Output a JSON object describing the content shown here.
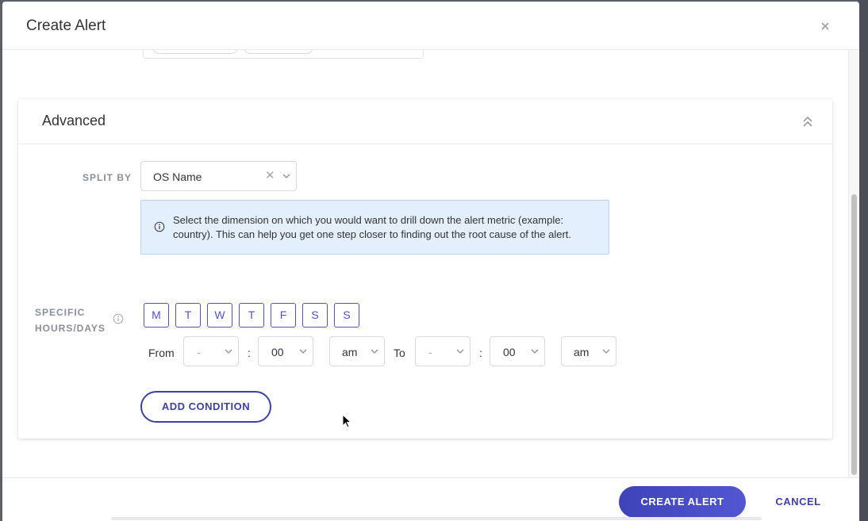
{
  "modal": {
    "title": "Create Alert",
    "close_icon": "close-icon"
  },
  "advanced": {
    "title": "Advanced",
    "collapse_icon": "double-chevron-up-icon",
    "split_by": {
      "label": "SPLIT BY",
      "value": "OS Name",
      "clear_icon": "clear-x-icon",
      "dropdown_icon": "chevron-down-icon"
    },
    "info": {
      "icon": "info-circle-icon",
      "text": "Select the dimension on which you would want to drill down the alert metric (example: country). This can help you get one step closer to finding out the root cause of the alert."
    },
    "specific_hours": {
      "label_line1": "SPECIFIC",
      "label_line2": "HOURS/DAYS",
      "info_icon": "info-circle-icon",
      "days": [
        "M",
        "T",
        "W",
        "T",
        "F",
        "S",
        "S"
      ],
      "from_label": "From",
      "to_label": "To",
      "separator": ":",
      "from_hour": "-",
      "from_minute": "00",
      "from_period": "am",
      "to_hour": "-",
      "to_minute": "00",
      "to_period": "am"
    },
    "add_condition_label": "ADD CONDITION"
  },
  "footer": {
    "create_label": "CREATE ALERT",
    "cancel_label": "CANCEL"
  },
  "colors": {
    "accent": "#4c52c8",
    "primary_button": "#4347c4",
    "info_bg": "#e3effc",
    "info_border": "#b8d2ef",
    "label_gray": "#8a8e96"
  }
}
